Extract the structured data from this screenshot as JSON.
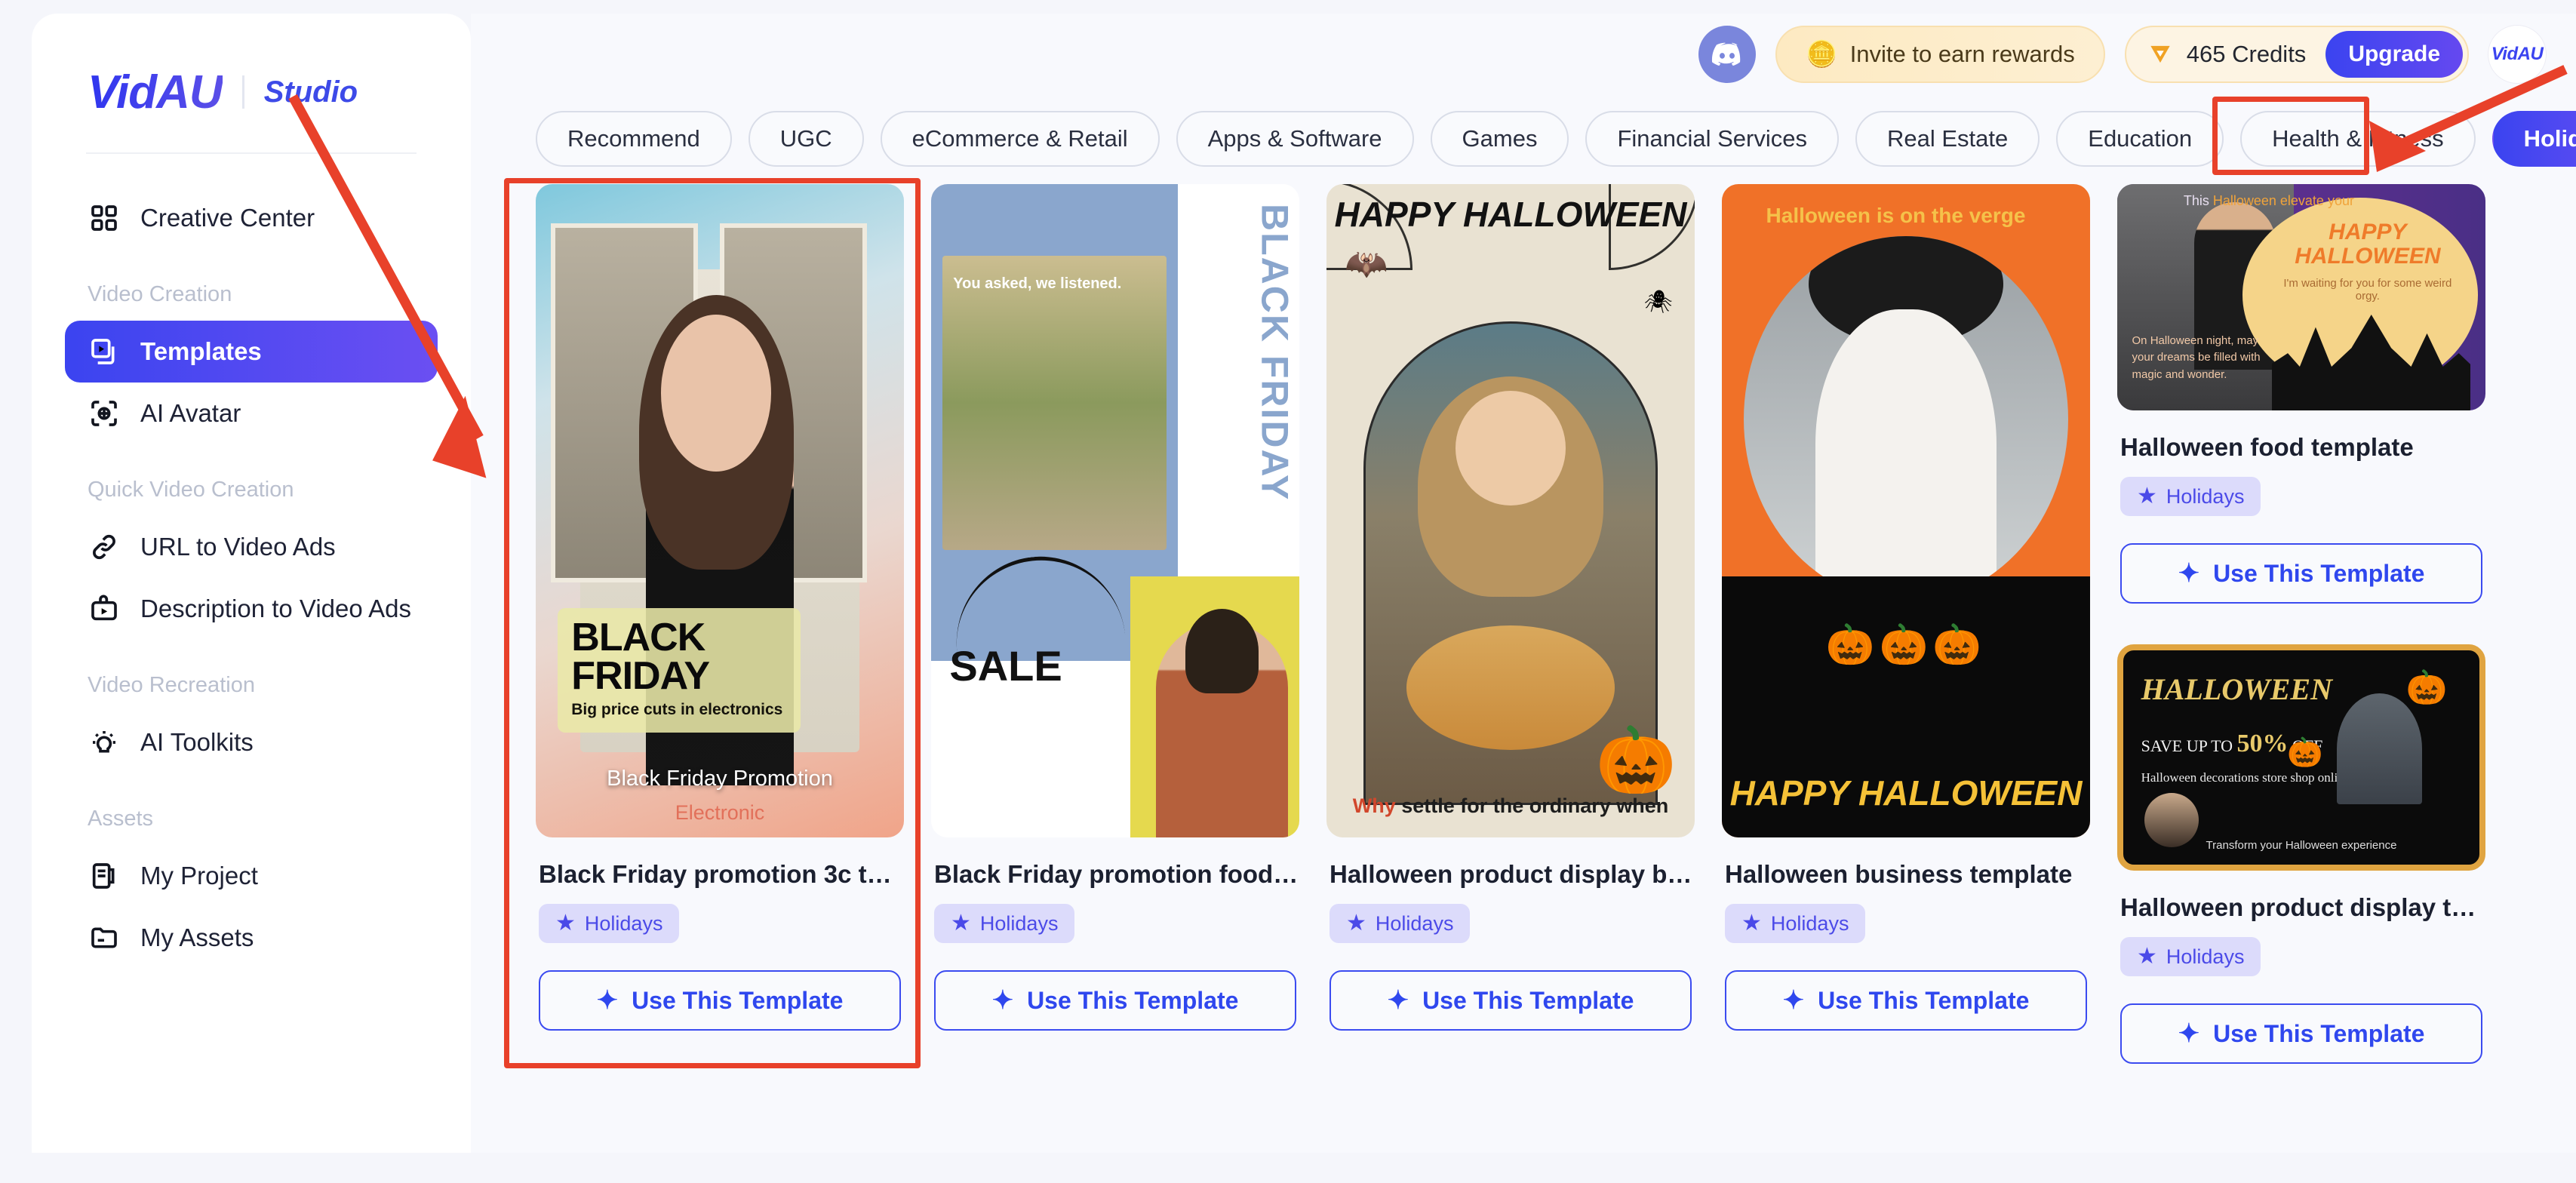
{
  "brand": {
    "name": "VidAU",
    "sub": "Studio"
  },
  "sidebar": {
    "top_items": [
      {
        "label": "Creative Center",
        "icon": "grid-icon"
      }
    ],
    "groups": [
      {
        "label": "Video Creation",
        "items": [
          {
            "label": "Templates",
            "icon": "templates-icon",
            "active": true
          },
          {
            "label": "AI Avatar",
            "icon": "avatar-icon",
            "active": false
          }
        ]
      },
      {
        "label": "Quick Video Creation",
        "items": [
          {
            "label": "URL to Video Ads",
            "icon": "link-icon",
            "active": false
          },
          {
            "label": "Description to Video Ads",
            "icon": "description-icon",
            "active": false
          }
        ]
      },
      {
        "label": "Video Recreation",
        "items": [
          {
            "label": "AI Toolkits",
            "icon": "lightbulb-icon",
            "active": false
          }
        ]
      },
      {
        "label": "Assets",
        "items": [
          {
            "label": "My Project",
            "icon": "project-icon",
            "active": false
          },
          {
            "label": "My Assets",
            "icon": "folder-icon",
            "active": false
          }
        ]
      }
    ]
  },
  "topbar": {
    "discord_icon": "discord-icon",
    "invite_label": "Invite to earn rewards",
    "invite_icon": "coins-icon",
    "credits_label": "465 Credits",
    "credits_icon": "v-diamond-icon",
    "upgrade_label": "Upgrade",
    "user_logo": "VidAU"
  },
  "tabs": [
    {
      "label": "Recommend",
      "selected": false
    },
    {
      "label": "UGC",
      "selected": false
    },
    {
      "label": "eCommerce & Retail",
      "selected": false
    },
    {
      "label": "Apps & Software",
      "selected": false
    },
    {
      "label": "Games",
      "selected": false
    },
    {
      "label": "Financial Services",
      "selected": false
    },
    {
      "label": "Real Estate",
      "selected": false
    },
    {
      "label": "Education",
      "selected": false
    },
    {
      "label": "Health & Fitness",
      "selected": false
    },
    {
      "label": "Holidays",
      "selected": true
    }
  ],
  "cards": [
    {
      "title": "Black Friday promotion 3c templ...",
      "chip": "Holidays",
      "button": "Use This Template",
      "art": {
        "headline": "BLACK FRIDAY",
        "subline": "Big price cuts in electronics",
        "caption": "Black Friday Promotion",
        "caption2": "Electronic"
      }
    },
    {
      "title": "Black Friday promotion food tem...",
      "chip": "Holidays",
      "button": "Use This Template",
      "art": {
        "overlay_text": "You asked, we listened.",
        "vertical_text": "BLACK FRIDAY",
        "sale_text": "SALE"
      }
    },
    {
      "title": "Halloween product display busin...",
      "chip": "Holidays",
      "button": "Use This Template",
      "art": {
        "headline": "HAPPY HALLOWEEN",
        "subline_highlight": "Why",
        "subline": " settle for the ordinary when"
      }
    },
    {
      "title": "Halloween business template",
      "chip": "Holidays",
      "button": "Use This Template",
      "art": {
        "top_white": "Halloween",
        "top_yellow": "is on the verge",
        "headline": "HAPPY HALLOWEEN"
      }
    },
    {
      "title": "Halloween food template",
      "chip": "Holidays",
      "button": "Use This Template",
      "art": {
        "top_text_plain": "This ",
        "top_text_accent": "Halloween elevate your",
        "headline": "HAPPY HALLOWEEN",
        "subline": "I'm waiting for you for some weird orgy.",
        "body": "On Halloween night, may your dreams be filled with magic and wonder."
      }
    },
    {
      "title": "Halloween product display templ...",
      "chip": "Holidays",
      "button": "Use This Template",
      "art": {
        "headline": "HALLOWEEN",
        "save_prefix": "SAVE UP TO ",
        "save_value": "50%",
        "save_suffix": " OFF",
        "body": "Halloween decorations store shop online",
        "footer": "Transform your Halloween experience"
      }
    }
  ],
  "annotations": {
    "highlight_color": "#e8412a",
    "rect_card": "first-template-card",
    "rect_tab": "holidays-tab"
  }
}
